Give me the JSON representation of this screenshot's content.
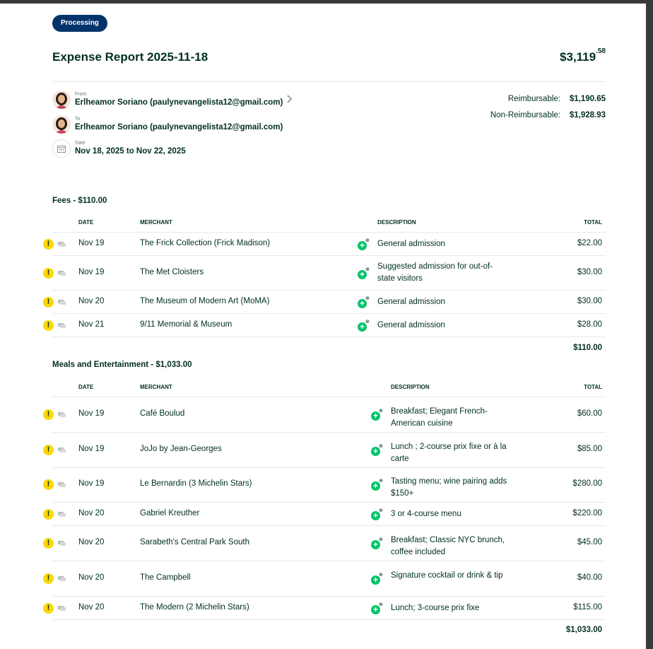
{
  "status": "Processing",
  "report_title": "Expense Report 2025-11-18",
  "total_main": "$3,119",
  "total_cents": ".58",
  "from": {
    "label": "From",
    "value": "Erlheamor Soriano (paulynevangelista12@gmail.com)"
  },
  "to": {
    "label": "To",
    "value": "Erlheamor Soriano (paulynevangelista12@gmail.com)"
  },
  "date": {
    "label": "Date",
    "value": "Nov 18, 2025 to Nov 22, 2025"
  },
  "summary": [
    {
      "label": "Reimbursable:",
      "value": "$1,190.65"
    },
    {
      "label": "Non-Reimbursable:",
      "value": "$1,928.93"
    }
  ],
  "columns": {
    "date": "DATE",
    "merchant": "MERCHANT",
    "description": "DESCRIPTION",
    "total": "TOTAL"
  },
  "sections": [
    {
      "title": "Fees - $110.00",
      "subtotal": "$110.00",
      "rows": [
        {
          "date": "Nov 19",
          "merchant": "The Frick Collection (Frick Madison)",
          "description": "General admission",
          "total": "$22.00"
        },
        {
          "date": "Nov 19",
          "merchant": "The Met Cloisters",
          "description": "Suggested admission for out-of-state visitors",
          "total": "$30.00"
        },
        {
          "date": "Nov 20",
          "merchant": "The Museum of Modern Art (MoMA)",
          "description": "General admission",
          "total": "$30.00"
        },
        {
          "date": "Nov 21",
          "merchant": "9/11 Memorial & Museum",
          "description": "General admission",
          "total": "$28.00"
        }
      ]
    },
    {
      "title": "Meals and Entertainment - $1,033.00",
      "subtotal": "$1,033.00",
      "rows": [
        {
          "date": "Nov 19",
          "merchant": "Café Boulud",
          "description": "Breakfast; Elegant French-American cuisine",
          "total": "$60.00"
        },
        {
          "date": "Nov 19",
          "merchant": "JoJo by Jean-Georges",
          "description": "Lunch ; 2-course prix fixe or à la carte",
          "total": "$85.00"
        },
        {
          "date": "Nov 19",
          "merchant": "Le Bernardin (3 Michelin Stars)",
          "description": "Tasting menu; wine pairing adds $150+",
          "total": "$280.00"
        },
        {
          "date": "Nov 20",
          "merchant": "Gabriel Kreuther",
          "description": "3 or 4-course menu",
          "total": "$220.00"
        },
        {
          "date": "Nov 20",
          "merchant": "Sarabeth's Central Park South",
          "description": "Breakfast; Classic NYC brunch, coffee included",
          "total": "$45.00"
        },
        {
          "date": "Nov 20",
          "merchant": "The Campbell",
          "description": "Signature cocktail or drink & tip",
          "total": "$40.00"
        },
        {
          "date": "Nov 20",
          "merchant": "The Modern (2 Michelin Stars)",
          "description": "Lunch; 3-course prix fixe",
          "total": "$115.00"
        }
      ]
    }
  ],
  "icons": {
    "warning": "warning-icon",
    "receipt": "receipt-icon",
    "add": "add-attendee-icon",
    "calendar": "calendar-icon",
    "chevron": "chevron-right-icon",
    "avatar": "avatar"
  },
  "glyphs": {
    "warning": "!",
    "plus": "+",
    "plus_sup": "⊕"
  },
  "colors": {
    "brand": "#03336b",
    "text": "#002e22",
    "warning": "#fcd700",
    "add": "#04c36a",
    "divider": "#e6e9e8"
  }
}
